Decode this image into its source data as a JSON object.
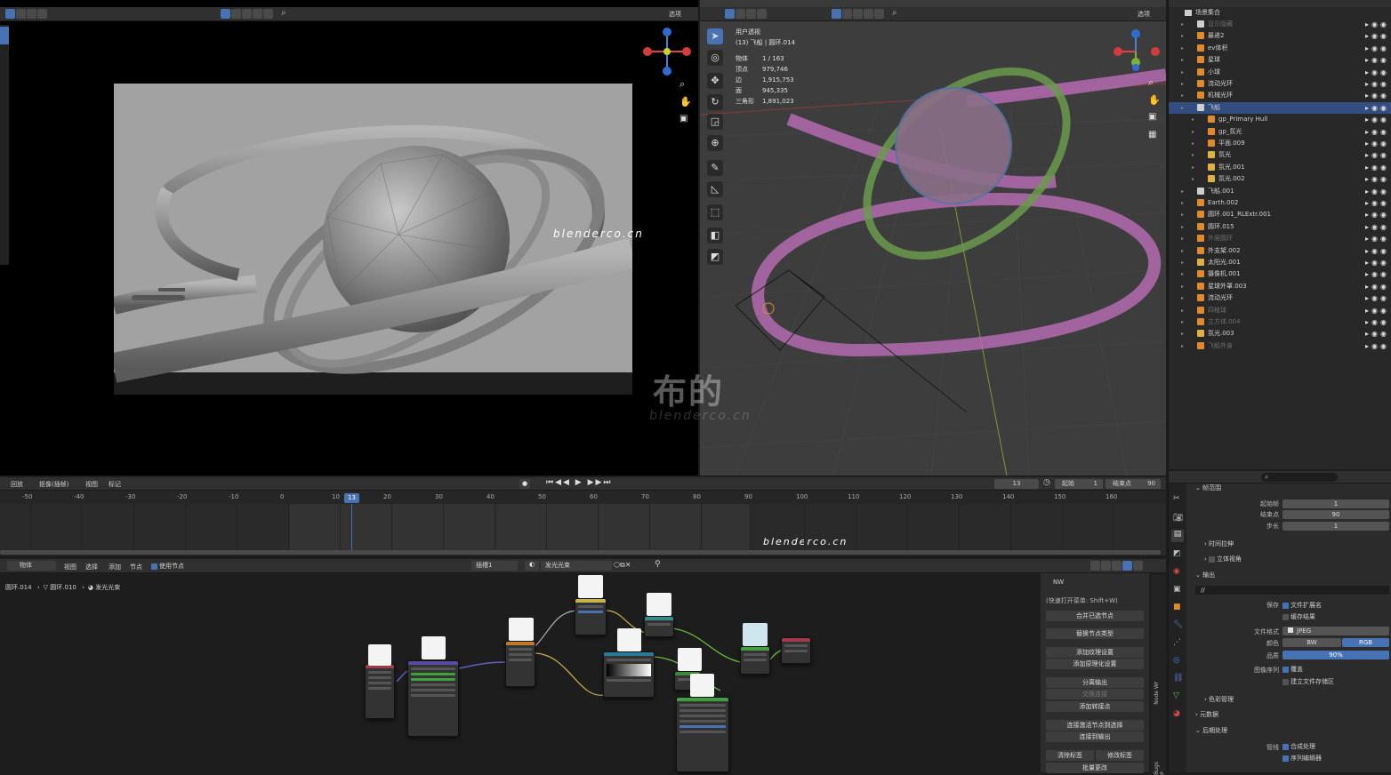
{
  "colors": {
    "accent": "#4772b3",
    "bg": "#1d1d1d",
    "panel": "#303030",
    "orange": "#e08a2e",
    "green": "#5fbf5f",
    "pink_tube": "#b46bb0"
  },
  "left_viewport": {
    "header_icons": [
      "select-box-icon",
      "mode-icons",
      "search-icon"
    ],
    "options_label": "选项"
  },
  "right_viewport": {
    "overlay": {
      "mode": "用户透视",
      "object": "(13) 飞船 | 圆环.014"
    },
    "stats": [
      {
        "k": "物体",
        "v": "1 / 163"
      },
      {
        "k": "顶点",
        "v": "979,746"
      },
      {
        "k": "边",
        "v": "1,915,753"
      },
      {
        "k": "面",
        "v": "945,335"
      },
      {
        "k": "三角形",
        "v": "1,891,023"
      }
    ],
    "options_label": "选项"
  },
  "outliner": {
    "title": "场景集合",
    "items": [
      {
        "name": "显示隐藏",
        "indent": 1,
        "type": "col",
        "dim": true
      },
      {
        "name": "最递2",
        "indent": 1,
        "type": "mesh"
      },
      {
        "name": "ev体积",
        "indent": 1,
        "type": "mesh"
      },
      {
        "name": "星球",
        "indent": 1,
        "type": "mesh"
      },
      {
        "name": "小球",
        "indent": 1,
        "type": "mesh"
      },
      {
        "name": "流动光环",
        "indent": 1,
        "type": "mesh"
      },
      {
        "name": "机械光环",
        "indent": 1,
        "type": "mesh"
      },
      {
        "name": "飞船",
        "indent": 1,
        "type": "col"
      },
      {
        "name": "gp_Primary Hull",
        "indent": 2,
        "type": "mesh"
      },
      {
        "name": "gp_氛光",
        "indent": 2,
        "type": "mesh"
      },
      {
        "name": "平面.009",
        "indent": 2,
        "type": "obj"
      },
      {
        "name": "氛光",
        "indent": 2,
        "type": "light"
      },
      {
        "name": "氛光.001",
        "indent": 2,
        "type": "light"
      },
      {
        "name": "氛光.002",
        "indent": 2,
        "type": "light"
      },
      {
        "name": "飞船.001",
        "indent": 1,
        "type": "col"
      },
      {
        "name": "Earth.002",
        "indent": 1,
        "type": "obj"
      },
      {
        "name": "圆环.001_RLExtr.001",
        "indent": 1,
        "type": "obj"
      },
      {
        "name": "圆环.015",
        "indent": 1,
        "type": "obj"
      },
      {
        "name": "外层圆环",
        "indent": 1,
        "type": "obj",
        "dim": true
      },
      {
        "name": "外支架.002",
        "indent": 1,
        "type": "curve"
      },
      {
        "name": "太阳光.001",
        "indent": 1,
        "type": "light"
      },
      {
        "name": "摄像机.001",
        "indent": 1,
        "type": "cam"
      },
      {
        "name": "星球外罩.003",
        "indent": 1,
        "type": "obj"
      },
      {
        "name": "流动光环",
        "indent": 1,
        "type": "mesh"
      },
      {
        "name": "四棱球",
        "indent": 1,
        "type": "obj",
        "dim": true
      },
      {
        "name": "立方体.004",
        "indent": 1,
        "type": "obj",
        "dim": true
      },
      {
        "name": "氛光.003",
        "indent": 1,
        "type": "light"
      },
      {
        "name": "飞船外身",
        "indent": 1,
        "type": "obj",
        "dim": true
      }
    ]
  },
  "timeline": {
    "menus": [
      "回放",
      "抠像(插帧)",
      "视图",
      "标记"
    ],
    "current_frame": "13",
    "start_label": "起始",
    "start": "1",
    "end_label": "结束点",
    "end": "90",
    "ticks": [
      "-50",
      "-40",
      "-30",
      "-20",
      "-10",
      "0",
      "10",
      "20",
      "30",
      "40",
      "50",
      "60",
      "70",
      "80",
      "90",
      "100",
      "110",
      "120",
      "130",
      "140",
      "150",
      "160"
    ],
    "playhead_label": "13"
  },
  "node_editor": {
    "menus": [
      "物体",
      "视图",
      "选择",
      "添加",
      "节点"
    ],
    "use_nodes": "使用节点",
    "slot": "插槽1",
    "material": "发光光束",
    "breadcrumb": [
      "圆环.014",
      "圆环.010",
      "发光光束"
    ],
    "n_panel": {
      "title": "NW",
      "shortcut": "(快速打开菜单: Shift+W)",
      "buttons": [
        "合并已选节点",
        "替换节点类型",
        "添加纹理设置",
        "添加原理化设置",
        "分离输出",
        "交换连接",
        "添加转接点",
        "连接激活节点到选择",
        "连接到输出",
        "清除标签",
        "修改标签",
        "批量更改"
      ],
      "tabs": [
        "Node Wr",
        "Bugs P"
      ]
    }
  },
  "properties": {
    "frame_range": {
      "title": "帧范围",
      "start_label": "起始帧",
      "start": "1",
      "end_label": "结束点",
      "end": "90",
      "step_label": "步长",
      "step": "1"
    },
    "time_stretch": "时间拉伸",
    "stereoscopy": "立体视角",
    "output": {
      "title": "输出",
      "path": "//",
      "save_label": "保存",
      "ext": "文件扩展名",
      "cache": "缓存结果",
      "format_label": "文件格式",
      "format": "JPEG",
      "color_label": "颜色",
      "bw": "BW",
      "rgb": "RGB",
      "quality_label": "品质",
      "quality": "90%",
      "seq_label": "图像序列",
      "overwrite": "覆盖",
      "placeholders": "建立文件存储区"
    },
    "color_mgmt": "色彩管理",
    "metadata": "元数据",
    "post": {
      "title": "后期处理",
      "pipeline_label": "管线",
      "compositing": "合成处理",
      "sequencer": "序列编辑器"
    }
  },
  "watermarks": {
    "site1": "blenderco.cn",
    "site2": "blenderco.cn",
    "brand": "布的",
    "site3": "blenderco.cn"
  }
}
